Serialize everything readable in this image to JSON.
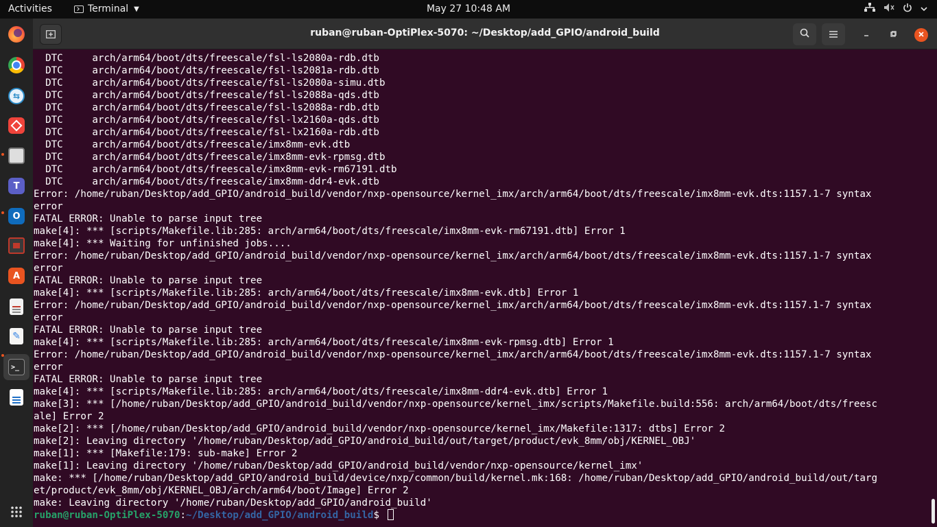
{
  "topbar": {
    "activities": "Activities",
    "app_name": "Terminal",
    "clock": "May 27  10:48 AM",
    "tray_icons": [
      "network-icon",
      "volume-muted-icon",
      "power-icon",
      "chevron-down-icon"
    ]
  },
  "dock": {
    "items": [
      {
        "name": "firefox",
        "icon": "firefox-icon",
        "color": "#ff7139"
      },
      {
        "name": "chrome",
        "icon": "chrome-icon",
        "color": "#4285f4"
      },
      {
        "name": "teamviewer-like",
        "icon": "remote-icon",
        "color": "#2d8cc8"
      },
      {
        "name": "anydesk",
        "icon": "anydesk-icon",
        "color": "#ef443b"
      },
      {
        "name": "files",
        "icon": "files-icon",
        "color": "#a8a8a8"
      },
      {
        "name": "teams",
        "icon": "teams-icon",
        "color": "#5b5fc7"
      },
      {
        "name": "outlook",
        "icon": "outlook-icon",
        "color": "#0f6cbd"
      },
      {
        "name": "screen-tool",
        "icon": "screen-icon",
        "color": "#c0392b"
      },
      {
        "name": "software",
        "icon": "software-store-icon",
        "color": "#e95420"
      },
      {
        "name": "document-viewer",
        "icon": "document-viewer-icon",
        "color": "#d9d9d9"
      },
      {
        "name": "text-editor",
        "icon": "text-editor-icon",
        "color": "#3584e4"
      },
      {
        "name": "terminal",
        "icon": "terminal-icon",
        "color": "#2e2e2e"
      },
      {
        "name": "writer",
        "icon": "writer-icon",
        "color": "#1e6fc6"
      }
    ],
    "show_apps_icon": "grid-icon"
  },
  "window": {
    "title": "ruban@ruban-OptiPlex-5070: ~/Desktop/add_GPIO/android_build",
    "new_tab_icon": "new-tab-icon",
    "search_icon": "search-icon",
    "menu_icon": "hamburger-menu-icon",
    "minimize_icon": "minimize-icon",
    "maximize_icon": "maximize-icon",
    "close_icon": "close-icon"
  },
  "terminal": {
    "lines": [
      "  DTC     arch/arm64/boot/dts/freescale/fsl-ls2080a-rdb.dtb",
      "  DTC     arch/arm64/boot/dts/freescale/fsl-ls2081a-rdb.dtb",
      "  DTC     arch/arm64/boot/dts/freescale/fsl-ls2080a-simu.dtb",
      "  DTC     arch/arm64/boot/dts/freescale/fsl-ls2088a-qds.dtb",
      "  DTC     arch/arm64/boot/dts/freescale/fsl-ls2088a-rdb.dtb",
      "  DTC     arch/arm64/boot/dts/freescale/fsl-lx2160a-qds.dtb",
      "  DTC     arch/arm64/boot/dts/freescale/fsl-lx2160a-rdb.dtb",
      "  DTC     arch/arm64/boot/dts/freescale/imx8mm-evk.dtb",
      "  DTC     arch/arm64/boot/dts/freescale/imx8mm-evk-rpmsg.dtb",
      "  DTC     arch/arm64/boot/dts/freescale/imx8mm-evk-rm67191.dtb",
      "  DTC     arch/arm64/boot/dts/freescale/imx8mm-ddr4-evk.dtb",
      "Error: /home/ruban/Desktop/add_GPIO/android_build/vendor/nxp-opensource/kernel_imx/arch/arm64/boot/dts/freescale/imx8mm-evk.dts:1157.1-7 syntax",
      "error",
      "FATAL ERROR: Unable to parse input tree",
      "make[4]: *** [scripts/Makefile.lib:285: arch/arm64/boot/dts/freescale/imx8mm-evk-rm67191.dtb] Error 1",
      "make[4]: *** Waiting for unfinished jobs....",
      "Error: /home/ruban/Desktop/add_GPIO/android_build/vendor/nxp-opensource/kernel_imx/arch/arm64/boot/dts/freescale/imx8mm-evk.dts:1157.1-7 syntax",
      "error",
      "FATAL ERROR: Unable to parse input tree",
      "make[4]: *** [scripts/Makefile.lib:285: arch/arm64/boot/dts/freescale/imx8mm-evk.dtb] Error 1",
      "Error: /home/ruban/Desktop/add_GPIO/android_build/vendor/nxp-opensource/kernel_imx/arch/arm64/boot/dts/freescale/imx8mm-evk.dts:1157.1-7 syntax",
      "error",
      "FATAL ERROR: Unable to parse input tree",
      "make[4]: *** [scripts/Makefile.lib:285: arch/arm64/boot/dts/freescale/imx8mm-evk-rpmsg.dtb] Error 1",
      "Error: /home/ruban/Desktop/add_GPIO/android_build/vendor/nxp-opensource/kernel_imx/arch/arm64/boot/dts/freescale/imx8mm-evk.dts:1157.1-7 syntax",
      "error",
      "FATAL ERROR: Unable to parse input tree",
      "make[4]: *** [scripts/Makefile.lib:285: arch/arm64/boot/dts/freescale/imx8mm-ddr4-evk.dtb] Error 1",
      "make[3]: *** [/home/ruban/Desktop/add_GPIO/android_build/vendor/nxp-opensource/kernel_imx/scripts/Makefile.build:556: arch/arm64/boot/dts/freesc",
      "ale] Error 2",
      "make[2]: *** [/home/ruban/Desktop/add_GPIO/android_build/vendor/nxp-opensource/kernel_imx/Makefile:1317: dtbs] Error 2",
      "make[2]: Leaving directory '/home/ruban/Desktop/add_GPIO/android_build/out/target/product/evk_8mm/obj/KERNEL_OBJ'",
      "make[1]: *** [Makefile:179: sub-make] Error 2",
      "make[1]: Leaving directory '/home/ruban/Desktop/add_GPIO/android_build/vendor/nxp-opensource/kernel_imx'",
      "make: *** [/home/ruban/Desktop/add_GPIO/android_build/device/nxp/common/build/kernel.mk:168: /home/ruban/Desktop/add_GPIO/android_build/out/targ",
      "et/product/evk_8mm/obj/KERNEL_OBJ/arch/arm64/boot/Image] Error 2",
      "make: Leaving directory '/home/ruban/Desktop/add_GPIO/android_build'"
    ],
    "prompt_user": "ruban@ruban-OptiPlex-5070",
    "prompt_sep": ":",
    "prompt_path": "~/Desktop/add_GPIO/android_build",
    "prompt_symbol": "$ "
  }
}
